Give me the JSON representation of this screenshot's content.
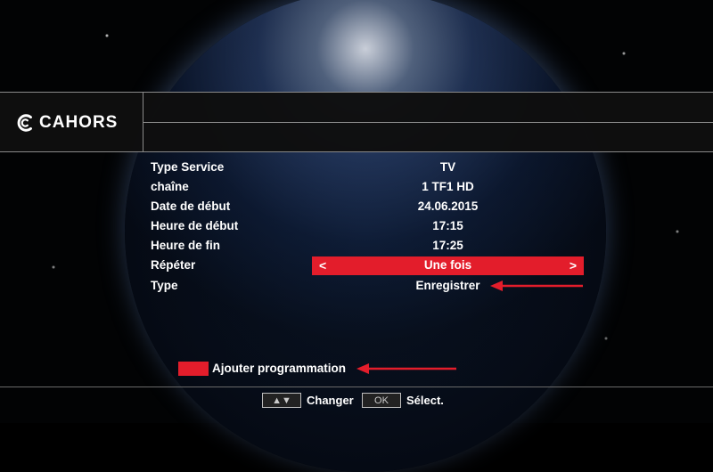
{
  "brand": {
    "name": "CAHORS"
  },
  "details": [
    {
      "label": "Type Service",
      "value": "TV"
    },
    {
      "label": "chaîne",
      "value": "1 TF1 HD"
    },
    {
      "label": "Date de début",
      "value": "24.06.2015"
    },
    {
      "label": "Heure de début",
      "value": "17:15"
    },
    {
      "label": "Heure de fin",
      "value": "17:25"
    },
    {
      "label": "Répéter",
      "value": "Une fois"
    },
    {
      "label": "Type",
      "value": "Enregistrer"
    }
  ],
  "selector": {
    "left_glyph": "<",
    "right_glyph": ">"
  },
  "action": {
    "label": "Ajouter programmation",
    "button_color": "#e31d2b"
  },
  "footer": {
    "change_key": "▲▼",
    "change_label": "Changer",
    "ok_key": "OK",
    "select_label": "Sélect."
  },
  "colors": {
    "accent": "#e31d2b",
    "annotation_arrow": "#e31d2b"
  },
  "icons": {
    "logo": "cahors-logo-icon",
    "annotation": "red-arrow-icon"
  }
}
